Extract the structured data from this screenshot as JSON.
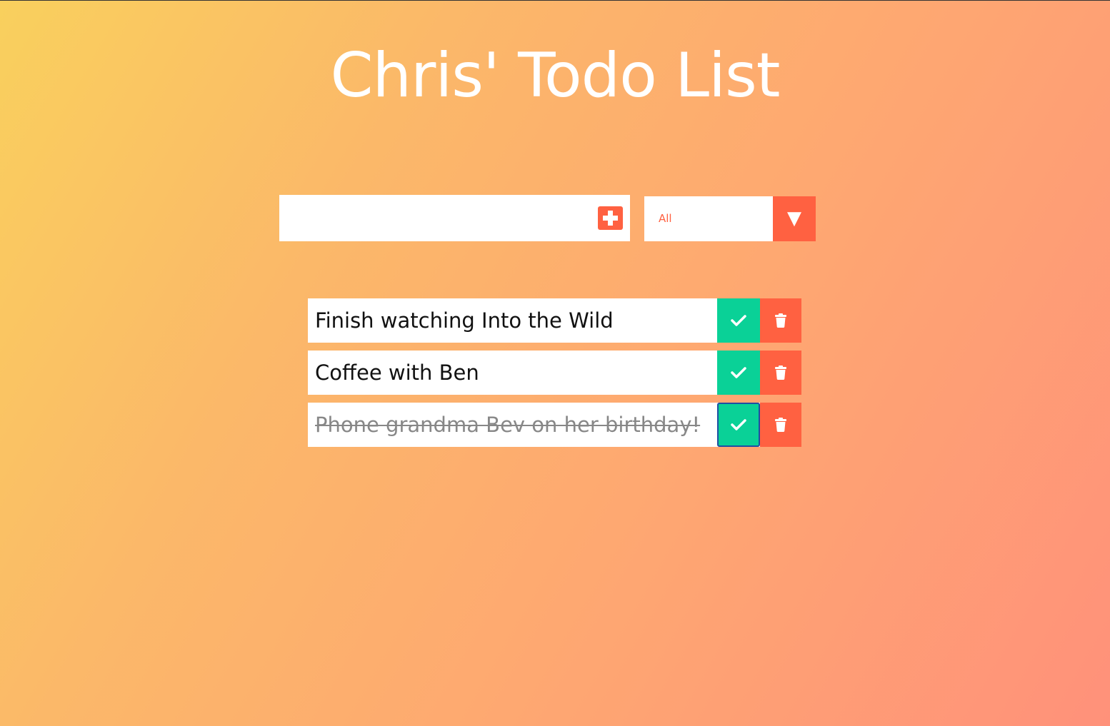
{
  "page": {
    "title": "Chris' Todo List"
  },
  "form": {
    "input_value": "",
    "add_icon": "plus-square-icon",
    "filter": {
      "selected": "All",
      "arrow_icon": "caret-down-icon"
    }
  },
  "todos": [
    {
      "text": "Finish watching Into the Wild",
      "completed": false
    },
    {
      "text": "Coffee with Ben",
      "completed": false
    },
    {
      "text": "Phone grandma Bev on her birthday!",
      "completed": true
    }
  ],
  "colors": {
    "accent": "#ff6141",
    "complete": "#0ad197",
    "gradient_start": "#f9d05d",
    "gradient_end": "#ff917a"
  }
}
